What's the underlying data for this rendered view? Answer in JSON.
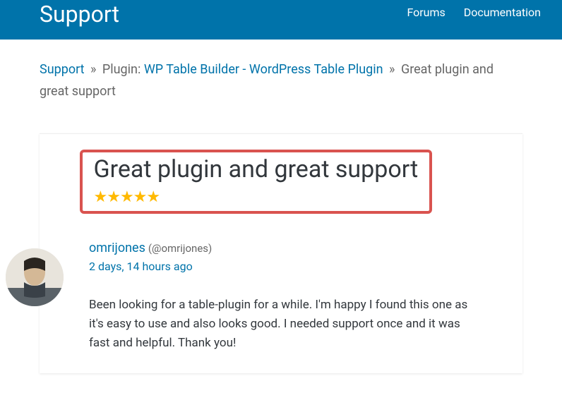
{
  "header": {
    "title": "Support",
    "nav": {
      "forums": "Forums",
      "documentation": "Documentation"
    }
  },
  "breadcrumb": {
    "root": "Support",
    "sep1": "»",
    "plugin_prefix": "Plugin: ",
    "plugin_link": "WP Table Builder - WordPress Table Plugin",
    "sep2": "»",
    "current": "Great plugin and great support"
  },
  "review": {
    "title": "Great plugin and great support",
    "stars": "★★★★★",
    "rating": 5,
    "author": {
      "display": "omrijones",
      "handle": "(@omrijones)"
    },
    "timestamp": "2 days, 14 hours ago",
    "body": "Been looking for a table-plugin for a while. I'm happy I found this one as it's easy to use and also looks good. I needed support once and it was fast and helpful. Thank you!"
  }
}
